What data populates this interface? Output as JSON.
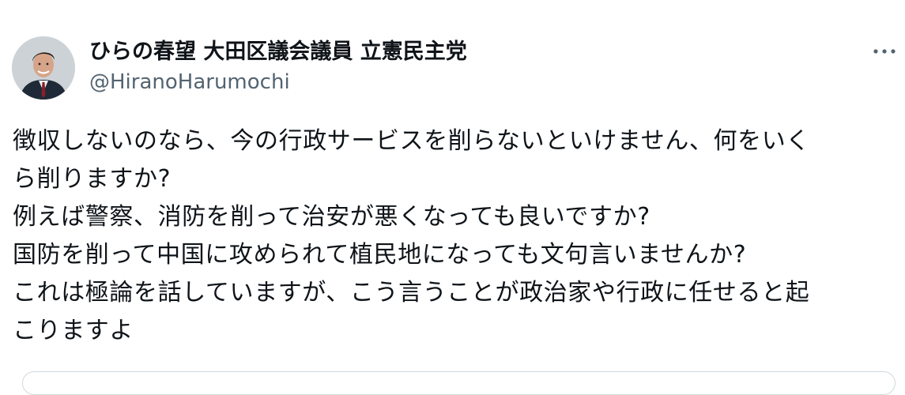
{
  "author": {
    "display_name": "ひらの春望 大田区議会議員 立憲民主党",
    "handle": "@HiranoHarumochi",
    "avatar_icon": "profile-photo"
  },
  "menu": {
    "icon": "more-horizontal-icon"
  },
  "tweet": {
    "lines": [
      "徴収しないのなら、今の行政サービスを削らないといけません、何をいく",
      "ら削りますか?",
      "例えば警察、消防を削って治安が悪くなっても良いですか?",
      "国防を削って中国に攻められて植民地になっても文句言いませんか?",
      "これは極論を話していますが、こう言うことが政治家や行政に任せると起",
      "こりますよ"
    ]
  },
  "colors": {
    "text": "#0f1419",
    "secondary": "#536471",
    "border": "#cfd9de"
  }
}
